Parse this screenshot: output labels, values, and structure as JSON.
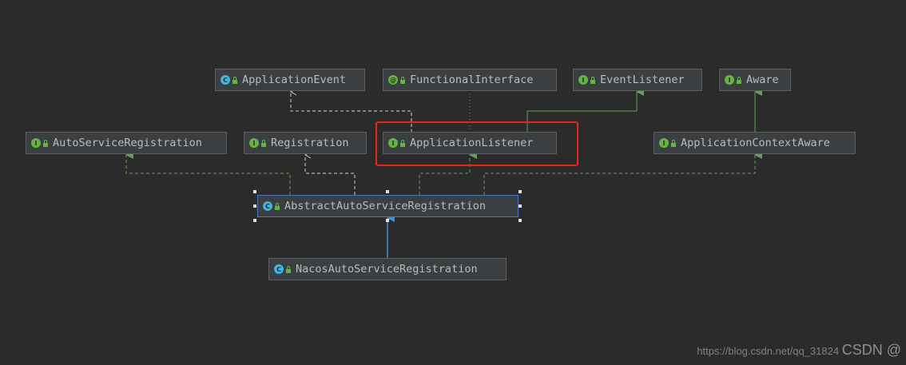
{
  "nodes": {
    "application_event": {
      "label": "ApplicationEvent",
      "kind": "C"
    },
    "functional_interface": {
      "label": "FunctionalInterface",
      "kind": "@"
    },
    "event_listener": {
      "label": "EventListener",
      "kind": "I"
    },
    "aware": {
      "label": "Aware",
      "kind": "I"
    },
    "auto_service_registration": {
      "label": "AutoServiceRegistration",
      "kind": "I"
    },
    "registration": {
      "label": "Registration",
      "kind": "I"
    },
    "application_listener": {
      "label": "ApplicationListener",
      "kind": "I"
    },
    "application_context_aware": {
      "label": "ApplicationContextAware",
      "kind": "I"
    },
    "abstract_auto_service_registration": {
      "label": "AbstractAutoServiceRegistration",
      "kind": "C"
    },
    "nacos_auto_service_registration": {
      "label": "NacosAutoServiceRegistration",
      "kind": "C"
    }
  },
  "watermark": {
    "csdn": "CSDN @",
    "url": "https://blog.csdn.net/qq_31824"
  },
  "colors": {
    "background": "#2b2b2b",
    "node_fill": "#3c3f41",
    "interface_edge": "#62a055",
    "class_extends_edge": "#4a88e0",
    "dependency_edge": "#bbbbbb",
    "highlight": "#e8231a"
  }
}
